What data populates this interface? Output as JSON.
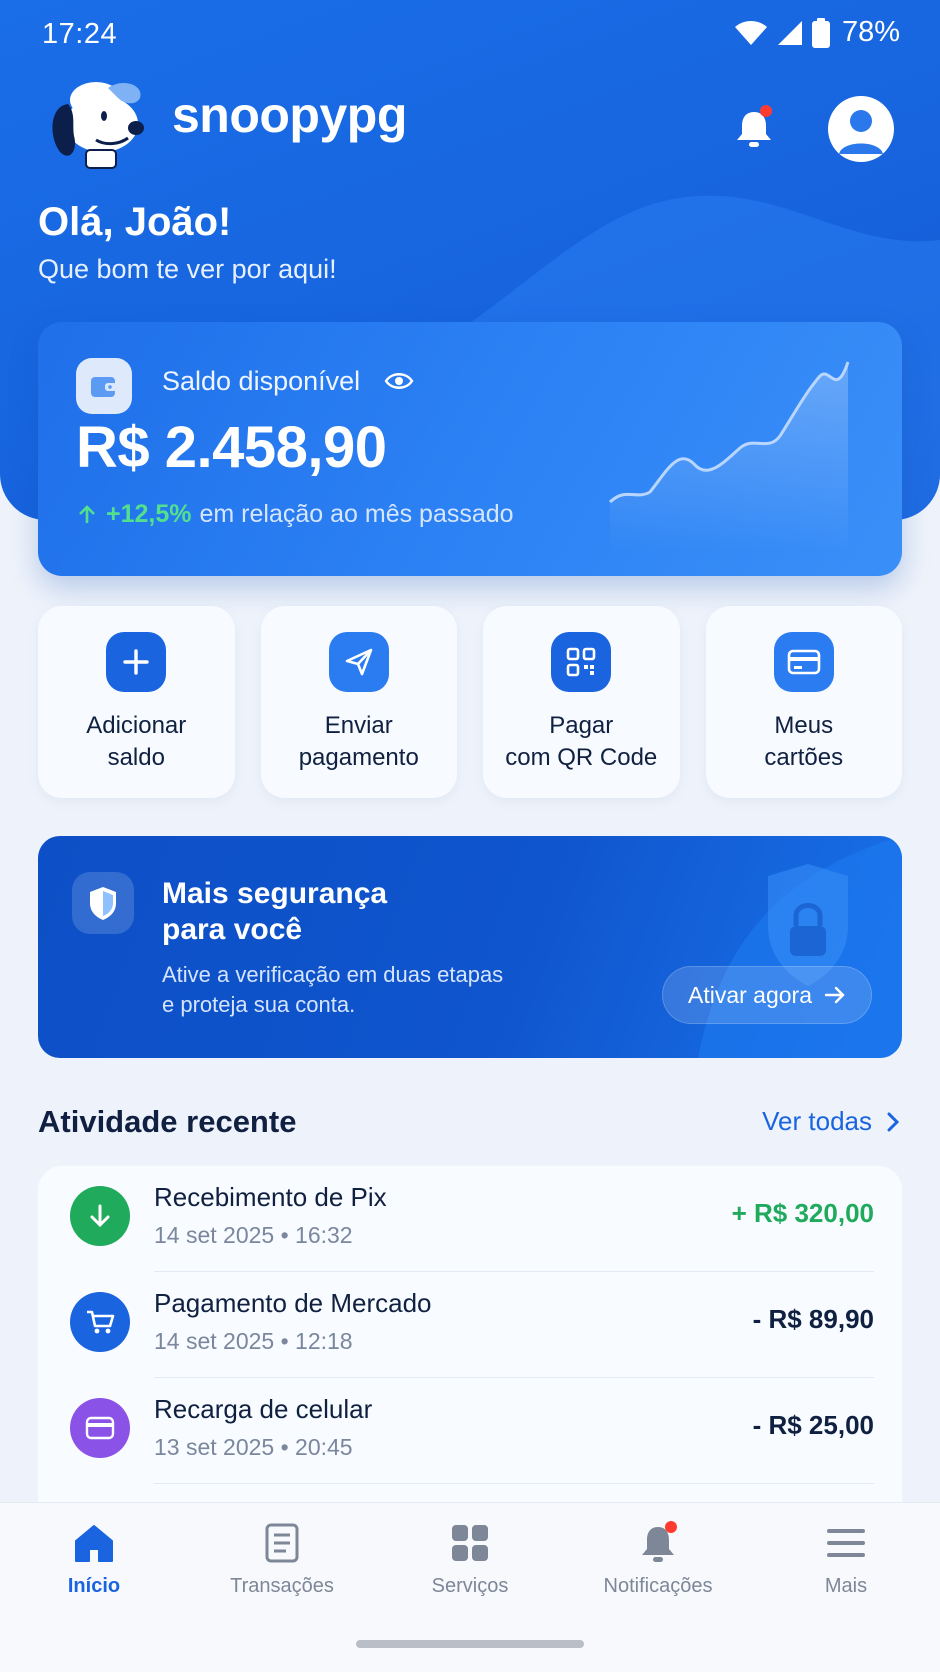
{
  "status": {
    "time": "17:24",
    "battery": "78%"
  },
  "header": {
    "brand": "snoopypg"
  },
  "greeting": {
    "title": "Olá, João!",
    "subtitle": "Que bom te ver por aqui!"
  },
  "balance": {
    "label": "Saldo disponível",
    "value": "R$ 2.458,90",
    "trend_pct": "+12,5%",
    "trend_text": "em relação ao mês passado"
  },
  "actions": [
    {
      "line1": "Adicionar",
      "line2": "saldo",
      "icon": "plus-icon"
    },
    {
      "line1": "Enviar",
      "line2": "pagamento",
      "icon": "send-icon"
    },
    {
      "line1": "Pagar",
      "line2": "com QR Code",
      "icon": "qr-code-icon"
    },
    {
      "line1": "Meus",
      "line2": "cartões",
      "icon": "credit-card-icon"
    }
  ],
  "security": {
    "title_line1": "Mais segurança",
    "title_line2": "para você",
    "desc_line1": "Ative a verificação em duas etapas",
    "desc_line2": "e proteja sua conta.",
    "cta": "Ativar agora"
  },
  "activity": {
    "title": "Atividade recente",
    "see_all": "Ver todas",
    "items": [
      {
        "title": "Recebimento de Pix",
        "date": "14 set 2025 • 16:32",
        "amount": "+ R$ 320,00",
        "icon": "arrow-down-icon"
      },
      {
        "title": "Pagamento de Mercado",
        "date": "14 set 2025 • 12:18",
        "amount": "- R$ 89,90",
        "icon": "cart-icon"
      },
      {
        "title": "Recarga de celular",
        "date": "13 set 2025 • 20:45",
        "amount": "- R$ 25,00",
        "icon": "card-icon"
      }
    ]
  },
  "tabs": [
    {
      "label": "Início",
      "icon": "home-icon",
      "active": true
    },
    {
      "label": "Transações",
      "icon": "receipt-icon"
    },
    {
      "label": "Serviços",
      "icon": "grid-icon"
    },
    {
      "label": "Notificações",
      "icon": "bell-icon"
    },
    {
      "label": "Mais",
      "icon": "menu-icon"
    }
  ],
  "colors": {
    "primary": "#1a64e0",
    "positive": "#1faa5c",
    "negative": "#102040",
    "pix_icon_bg": "#1faa5c",
    "cart_icon_bg": "#1a64e0",
    "card_icon_bg": "#8a52e6"
  }
}
